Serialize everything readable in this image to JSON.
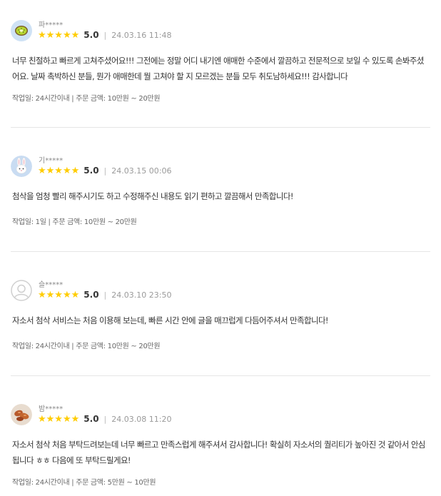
{
  "reviews": [
    {
      "nickname": "파*****",
      "avatar_icon": "kiwi-icon",
      "stars": "★★★★★",
      "score": "5.0",
      "date": "24.03.16 11:48",
      "body": "너무 친절하고 빠르게 고쳐주셨어요!!! 그전에는 정말 어디 내기엔 애매한 수준에서 깔끔하고 전문적으로 보일 수 있도록 손봐주셨어요. 날짜 촉박하신 분들, 뭔가 애매한데 뭘 고쳐야 할 지 모르겠는 분들 모두 취도남하세요!!! 감사합니다",
      "meta": "작업일: 24시간이내 | 주문 금액: 10만원 ~ 20만원"
    },
    {
      "nickname": "기*****",
      "avatar_icon": "rabbit-icon",
      "stars": "★★★★★",
      "score": "5.0",
      "date": "24.03.15 00:06",
      "body": "첨삭을 엄청 빨리 해주시기도 하고 수정해주신 내용도 읽기 편하고 깔끔해서 만족합니다!",
      "meta": "작업일: 1일 | 주문 금액: 10만원 ~ 20만원"
    },
    {
      "nickname": "슬*****",
      "avatar_icon": "default-user-icon",
      "stars": "★★★★★",
      "score": "5.0",
      "date": "24.03.10 23:50",
      "body": "자소서 첨삭 서비스는 처음 이용해 보는데, 빠른 시간 안에 글을 매끄럽게 다듬어주셔서 만족합니다!",
      "meta": "작업일: 24시간이내 | 주문 금액: 10만원 ~ 20만원"
    },
    {
      "nickname": "밤*****",
      "avatar_icon": "food-photo-icon",
      "stars": "★★★★★",
      "score": "5.0",
      "date": "24.03.08 11:20",
      "body": "자소서 첨삭 처음 부탁드려보는데 너무 빠르고 만족스럽게 해주셔서 감사합니다! 확실히 자소서의 퀄리티가 높아진 것 같아서 안심됩니다 ㅎㅎ 다음에 또 부탁드릴게요!",
      "meta": "작업일: 24시간이내 | 주문 금액: 5만원 ~ 10만원"
    }
  ],
  "colors": {
    "star": "#ffcc00",
    "divider": "#e6e6e6",
    "muted": "#9a9a9a"
  }
}
